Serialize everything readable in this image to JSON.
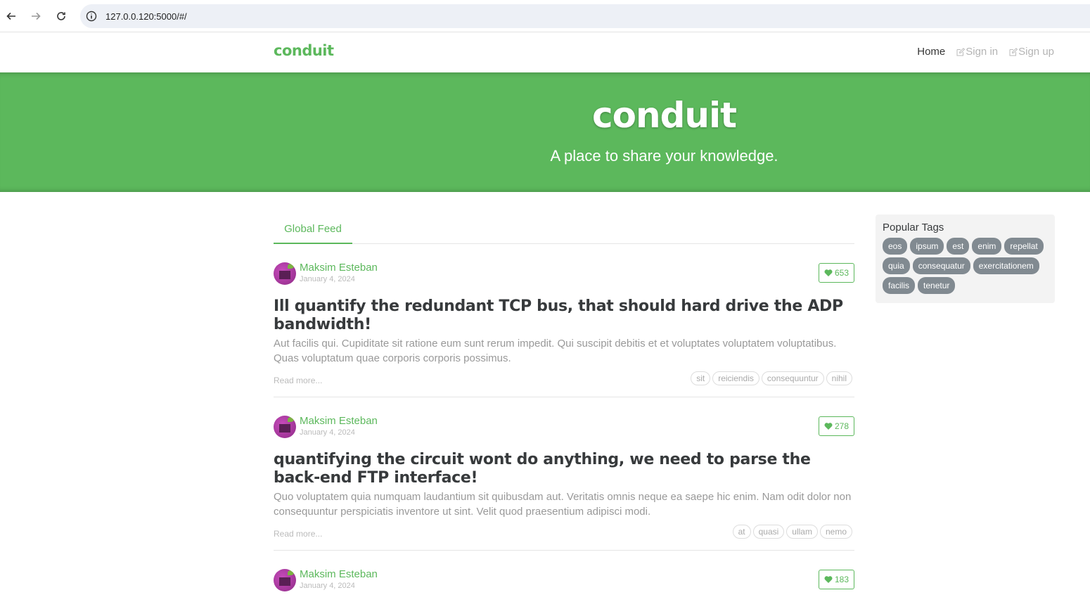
{
  "browser": {
    "url": "127.0.0.120:5000/#/"
  },
  "nav": {
    "brand": "conduit",
    "links": [
      "Home",
      "Sign in",
      "Sign up"
    ]
  },
  "banner": {
    "title": "conduit",
    "subtitle": "A place to share your knowledge."
  },
  "feed": {
    "tab": "Global Feed",
    "read_more": "Read more...",
    "articles": [
      {
        "author": "Maksim Esteban",
        "date": "January 4, 2024",
        "likes": "653",
        "title": "Ill quantify the redundant TCP bus, that should hard drive the ADP bandwidth!",
        "description": "Aut facilis qui. Cupiditate sit ratione eum sunt rerum impedit. Qui suscipit debitis et et voluptates voluptatem voluptatibus. Quas voluptatum quae corporis corporis possimus.",
        "tags": [
          "sit",
          "reiciendis",
          "consequuntur",
          "nihil"
        ]
      },
      {
        "author": "Maksim Esteban",
        "date": "January 4, 2024",
        "likes": "278",
        "title": "quantifying the circuit wont do anything, we need to parse the back-end FTP interface!",
        "description": "Quo voluptatem quia numquam laudantium sit quibusdam aut. Veritatis omnis neque ea saepe hic enim. Nam odit dolor non consequuntur perspiciatis inventore ut sint. Velit quod praesentium adipisci modi.",
        "tags": [
          "at",
          "quasi",
          "ullam",
          "nemo"
        ]
      },
      {
        "author": "Maksim Esteban",
        "date": "January 4, 2024",
        "likes": "183"
      }
    ]
  },
  "sidebar": {
    "title": "Popular Tags",
    "tags": [
      "eos",
      "ipsum",
      "est",
      "enim",
      "repellat",
      "quia",
      "consequatur",
      "exercitationem",
      "facilis",
      "tenetur"
    ]
  },
  "colors": {
    "brand": "#5cb85c",
    "tag_pill": "#818a91"
  }
}
